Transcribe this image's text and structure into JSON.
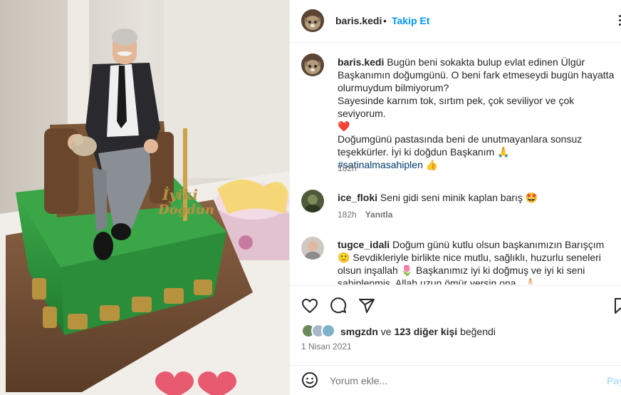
{
  "post": {
    "username": "baris.kedi",
    "separator": "•",
    "follow_label": "Takip Et"
  },
  "caption": {
    "username": "baris.kedi",
    "lines": [
      "Bugün beni sokakta bulup evlat edinen Ülgür",
      "Başkanımın doğumgünü. O beni fark etmeseydi bugün hayatta",
      "olurmuydum bilmiyorum?",
      "Sayesinde karnım tok, sırtım pek, çok seviliyor ve çok seviyorum.",
      "❤️",
      "Doğumgünü pastasında beni de unutmayanlara sonsuz",
      "teşekkürler. İyi ki doğdun Başkanım 🙏"
    ],
    "hashtag": "#satinalmasahiplen",
    "hashtag_emoji": "👍",
    "time": "182h"
  },
  "comments": [
    {
      "username": "ice_floki",
      "text": "Seni gidi seni minik kaplan barış 🤩",
      "time": "182h",
      "reply_label": "Yanıtla"
    },
    {
      "username": "tugce_idali",
      "lines": [
        "Doğum günü kutlu olsun başkanımızın Barışçım",
        "🙂 Sevdikleriyle birlikte nice mutlu, sağlıklı, huzurlu seneleri",
        "olsun inşallah 🌷 Başkanımız iyi ki doğmuş ve iyi ki seni",
        "sahiplenmiş. Allah uzun ömür versin ona.. 🙏🏻"
      ]
    }
  ],
  "likes": {
    "user": "smgzdn",
    "conjunction": "ve",
    "others": "123 diğer kişi",
    "suffix": "beğendi"
  },
  "date": "1 Nisan 2021",
  "add_comment": {
    "placeholder": "Yorum ekle...",
    "post_label": "Paylaş"
  },
  "photo": {
    "cake_text_line1": "İyiki",
    "cake_text_line2": "Doğdun"
  },
  "colors": {
    "link_blue": "#0095f6",
    "hashtag_blue": "#00376b",
    "muted_gray": "#737373",
    "post_disabled": "#b2dffc",
    "cake_green": "#2e9c3e",
    "heart_pink": "#e85a6f"
  },
  "icons": [
    "more-icon",
    "heart-outline-icon",
    "comment-icon",
    "share-icon",
    "bookmark-icon",
    "emoji-icon"
  ]
}
